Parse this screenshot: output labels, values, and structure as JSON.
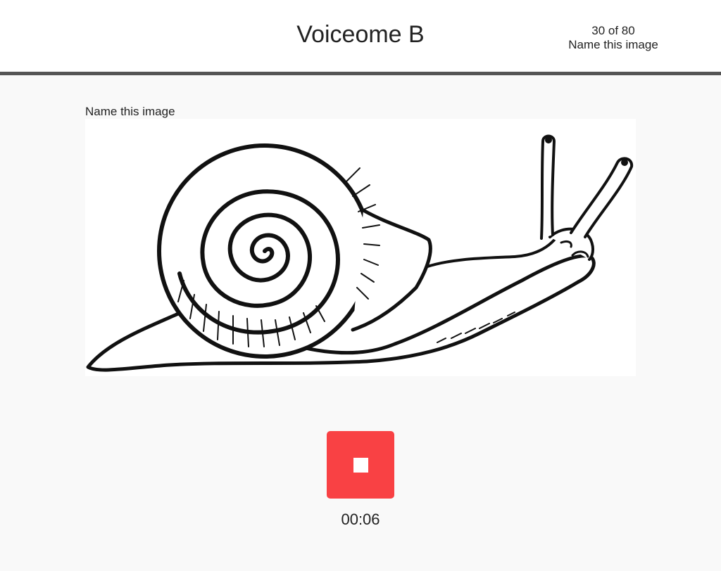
{
  "header": {
    "title": "Voiceome B",
    "progress": "30 of 80",
    "task": "Name this image"
  },
  "prompt": {
    "label": "Name this image",
    "image_subject": "snail-illustration"
  },
  "recorder": {
    "button_state": "recording",
    "icon": "stop-icon",
    "elapsed": "00:06",
    "button_color": "#f94144"
  },
  "colors": {
    "header_border": "#555555",
    "page_background": "#f9f9f9"
  }
}
